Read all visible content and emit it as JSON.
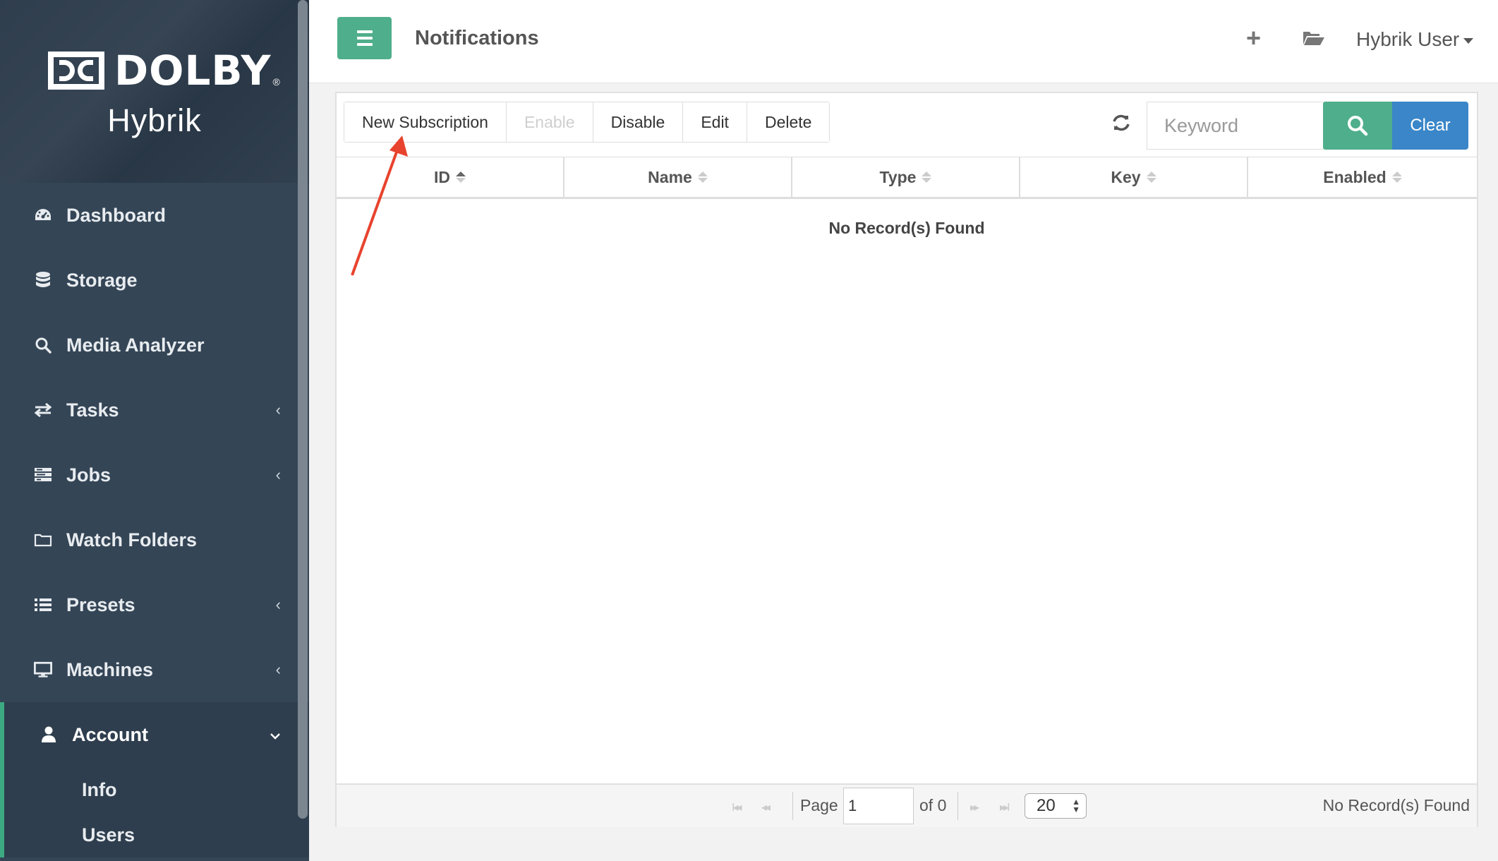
{
  "brand": {
    "logo_text": "DOLBY",
    "reg_mark": "®",
    "product": "Hybrik"
  },
  "sidebar": {
    "items": [
      {
        "label": "Dashboard",
        "icon": "dashboard-icon",
        "has_chevron": false
      },
      {
        "label": "Storage",
        "icon": "database-icon",
        "has_chevron": false
      },
      {
        "label": "Media Analyzer",
        "icon": "search-icon",
        "has_chevron": false
      },
      {
        "label": "Tasks",
        "icon": "exchange-icon",
        "has_chevron": true
      },
      {
        "label": "Jobs",
        "icon": "jobs-icon",
        "has_chevron": true
      },
      {
        "label": "Watch Folders",
        "icon": "folder-icon",
        "has_chevron": false
      },
      {
        "label": "Presets",
        "icon": "list-icon",
        "has_chevron": true
      },
      {
        "label": "Machines",
        "icon": "monitor-icon",
        "has_chevron": true
      },
      {
        "label": "Account",
        "icon": "user-icon",
        "expanded": true
      }
    ],
    "account_sub": [
      "Info",
      "Users"
    ],
    "chevron_left": "‹",
    "chevron_down": "⌄"
  },
  "header": {
    "title": "Notifications",
    "plus": "+",
    "user": "Hybrik User"
  },
  "toolbar": {
    "new_subscription": "New Subscription",
    "enable": "Enable",
    "disable": "Disable",
    "edit": "Edit",
    "delete": "Delete"
  },
  "search": {
    "placeholder": "Keyword",
    "clear": "Clear"
  },
  "table": {
    "columns": [
      "ID",
      "Name",
      "Type",
      "Key",
      "Enabled"
    ],
    "empty_message": "No Record(s) Found"
  },
  "pager": {
    "first": "I◂◂",
    "prev": "◂◂",
    "page_label": "Page",
    "page_value": "1",
    "of_label": "of 0",
    "next": "▸▸",
    "last": "▸▸I",
    "page_size": "20",
    "status": "No Record(s) Found"
  },
  "colors": {
    "sidebar": "#344556",
    "accent_green": "#4fae8b",
    "accent_blue": "#3a86c8",
    "annotation_arrow": "#e8432e"
  }
}
